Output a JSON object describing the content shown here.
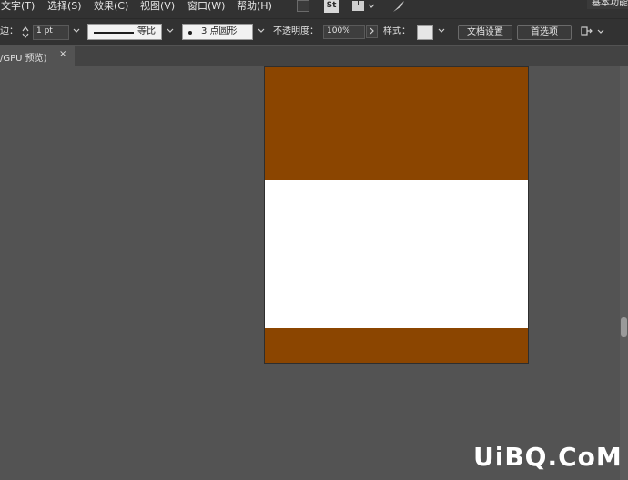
{
  "menubar": {
    "items": [
      "文字(T)",
      "选择(S)",
      "效果(C)",
      "视图(V)",
      "窗口(W)",
      "帮助(H)"
    ],
    "stock_label": "St",
    "workspace_label": "基本功能"
  },
  "controlbar": {
    "stroke_label": "边：",
    "stroke_weight": "1 pt",
    "stroke_profile": "等比",
    "brush": "3 点圆形",
    "opacity_label": "不透明度：",
    "opacity_value": "100%",
    "style_label": "样式：",
    "doc_setup_button": "文档设置",
    "preferences_button": "首选项"
  },
  "tabbar": {
    "doc_tab_label": "/GPU 预览)",
    "close_glyph": "×"
  },
  "artboard": {
    "bands": [
      {
        "name": "top-brown-band",
        "color": "#8b4500"
      },
      {
        "name": "middle-white-band",
        "color": "#ffffff"
      },
      {
        "name": "bottom-brown-band",
        "color": "#8b4500"
      }
    ]
  },
  "watermark": "UiBQ.CoM",
  "colors": {
    "background": "#535353",
    "chrome": "#323232",
    "brown": "#8b4500",
    "white": "#ffffff"
  }
}
